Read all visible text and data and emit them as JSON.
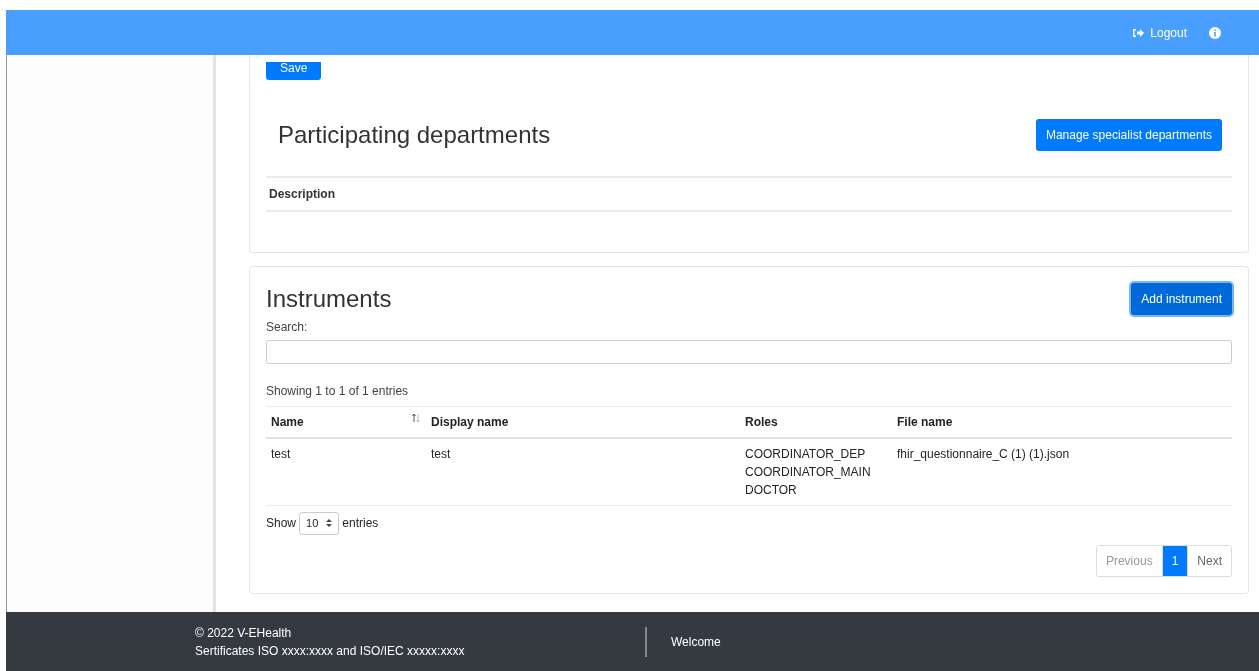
{
  "header": {
    "logout": "Logout"
  },
  "departments": {
    "save_button": "Save",
    "title": "Participating departments",
    "manage_button": "Manage specialist departments",
    "columns": [
      "Description"
    ]
  },
  "instruments": {
    "title": "Instruments",
    "add_button": "Add instrument",
    "search_label": "Search:",
    "info": "Showing 1 to 1 of 1 entries",
    "columns": [
      {
        "label": "Name",
        "sortable": true
      },
      {
        "label": "Display name",
        "sortable": false
      },
      {
        "label": "Roles",
        "sortable": false
      },
      {
        "label": "File name",
        "sortable": false
      }
    ],
    "rows": [
      {
        "cells": [
          [
            "test"
          ],
          [
            "test"
          ],
          [
            "COORDINATOR_DEP",
            "COORDINATOR_MAIN",
            "DOCTOR"
          ],
          [
            "fhir_questionnaire_C (1) (1).json"
          ]
        ]
      }
    ],
    "length": {
      "prefix": "Show",
      "value": "10",
      "suffix": "entries"
    },
    "pagination": [
      {
        "label": "Previous",
        "selected": false,
        "disabled": true
      },
      {
        "label": "1",
        "selected": true,
        "disabled": false
      },
      {
        "label": "Next",
        "selected": false,
        "disabled": false
      }
    ]
  },
  "footer": {
    "copyright": "© 2022 V-EHealth",
    "certificates": "Sertificates ISO xxxx:xxxx and ISO/IEC xxxxx:xxxx",
    "welcome": "Welcome"
  }
}
